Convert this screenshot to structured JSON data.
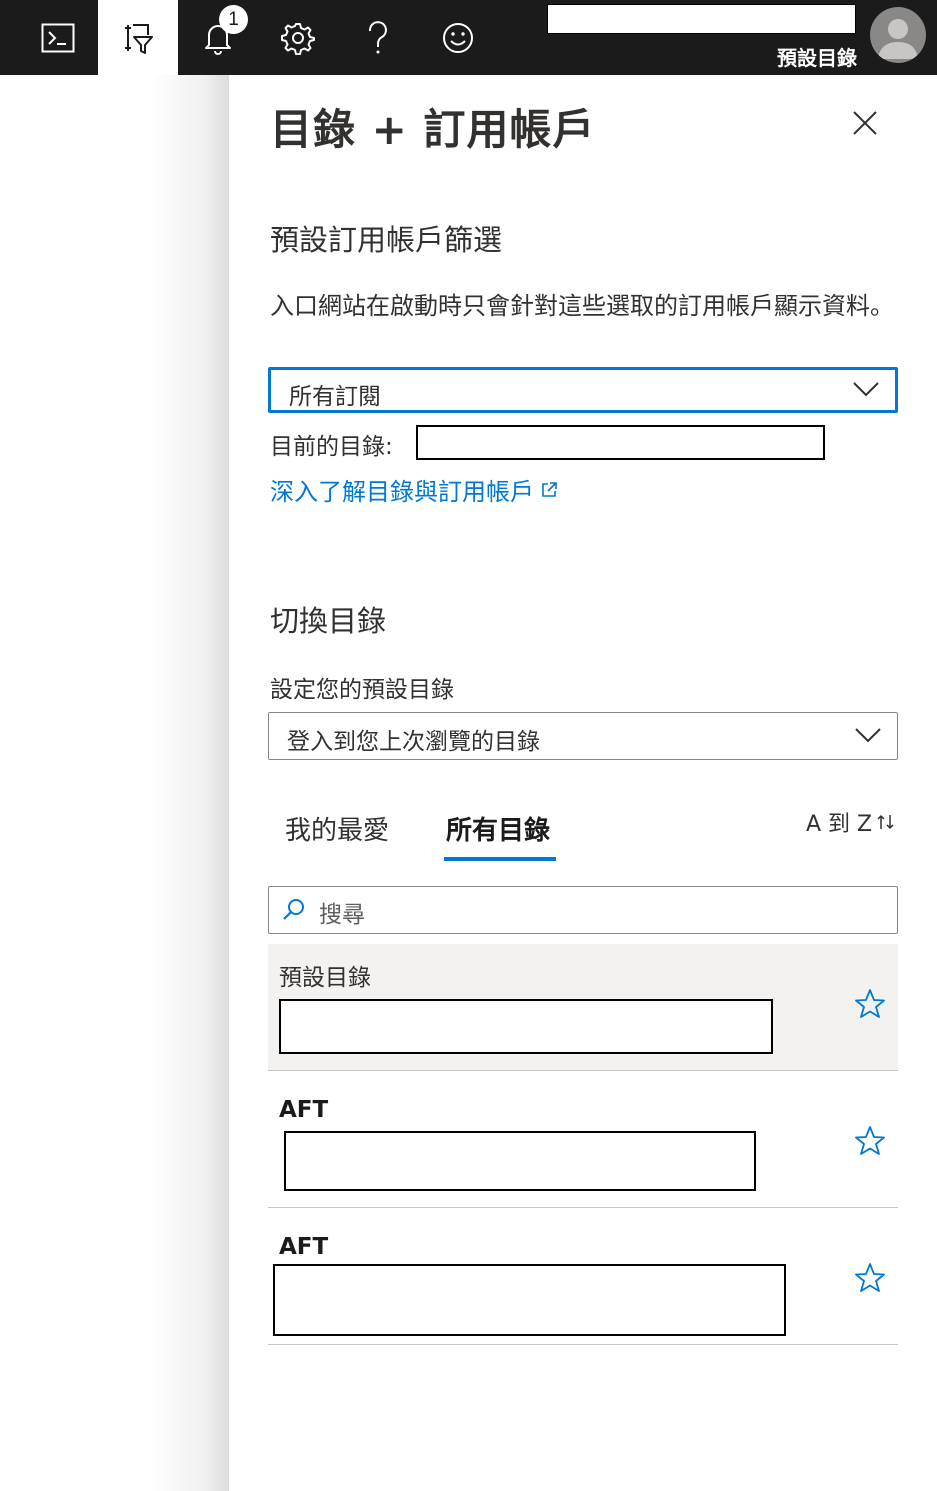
{
  "topbar": {
    "notification_count": "1",
    "directory_name": "預設目錄",
    "icons": [
      "cloud-shell-icon",
      "directory-filter-icon",
      "notifications-icon",
      "settings-icon",
      "help-icon",
      "feedback-icon"
    ]
  },
  "panel": {
    "title": "目錄 + 訂用帳戶",
    "default_filter": {
      "heading": "預設訂用帳戶篩選",
      "description": "入口網站在啟動時只會針對這些選取的訂用帳戶顯示資料。",
      "dropdown_value": "所有訂閱",
      "current_directory_label": "目前的目錄:",
      "learn_more_link": "深入了解目錄與訂用帳戶"
    },
    "switch_directory": {
      "heading": "切換目錄",
      "default_label": "設定您的預設目錄",
      "default_dropdown_value": "登入到您上次瀏覽的目錄",
      "tabs": [
        {
          "label": "我的最愛",
          "active": false
        },
        {
          "label": "所有目錄",
          "active": true
        }
      ],
      "sort_label": "A 到 Z",
      "search_placeholder": "搜尋",
      "directories": [
        {
          "name": "預設目錄",
          "selected": true
        },
        {
          "name": "AFT",
          "selected": false
        },
        {
          "name": "AFT",
          "selected": false
        }
      ]
    }
  },
  "colors": {
    "topbar_bg": "#1b1b1b",
    "accent": "#0078d4",
    "selected_row_bg": "#f3f2f1"
  }
}
